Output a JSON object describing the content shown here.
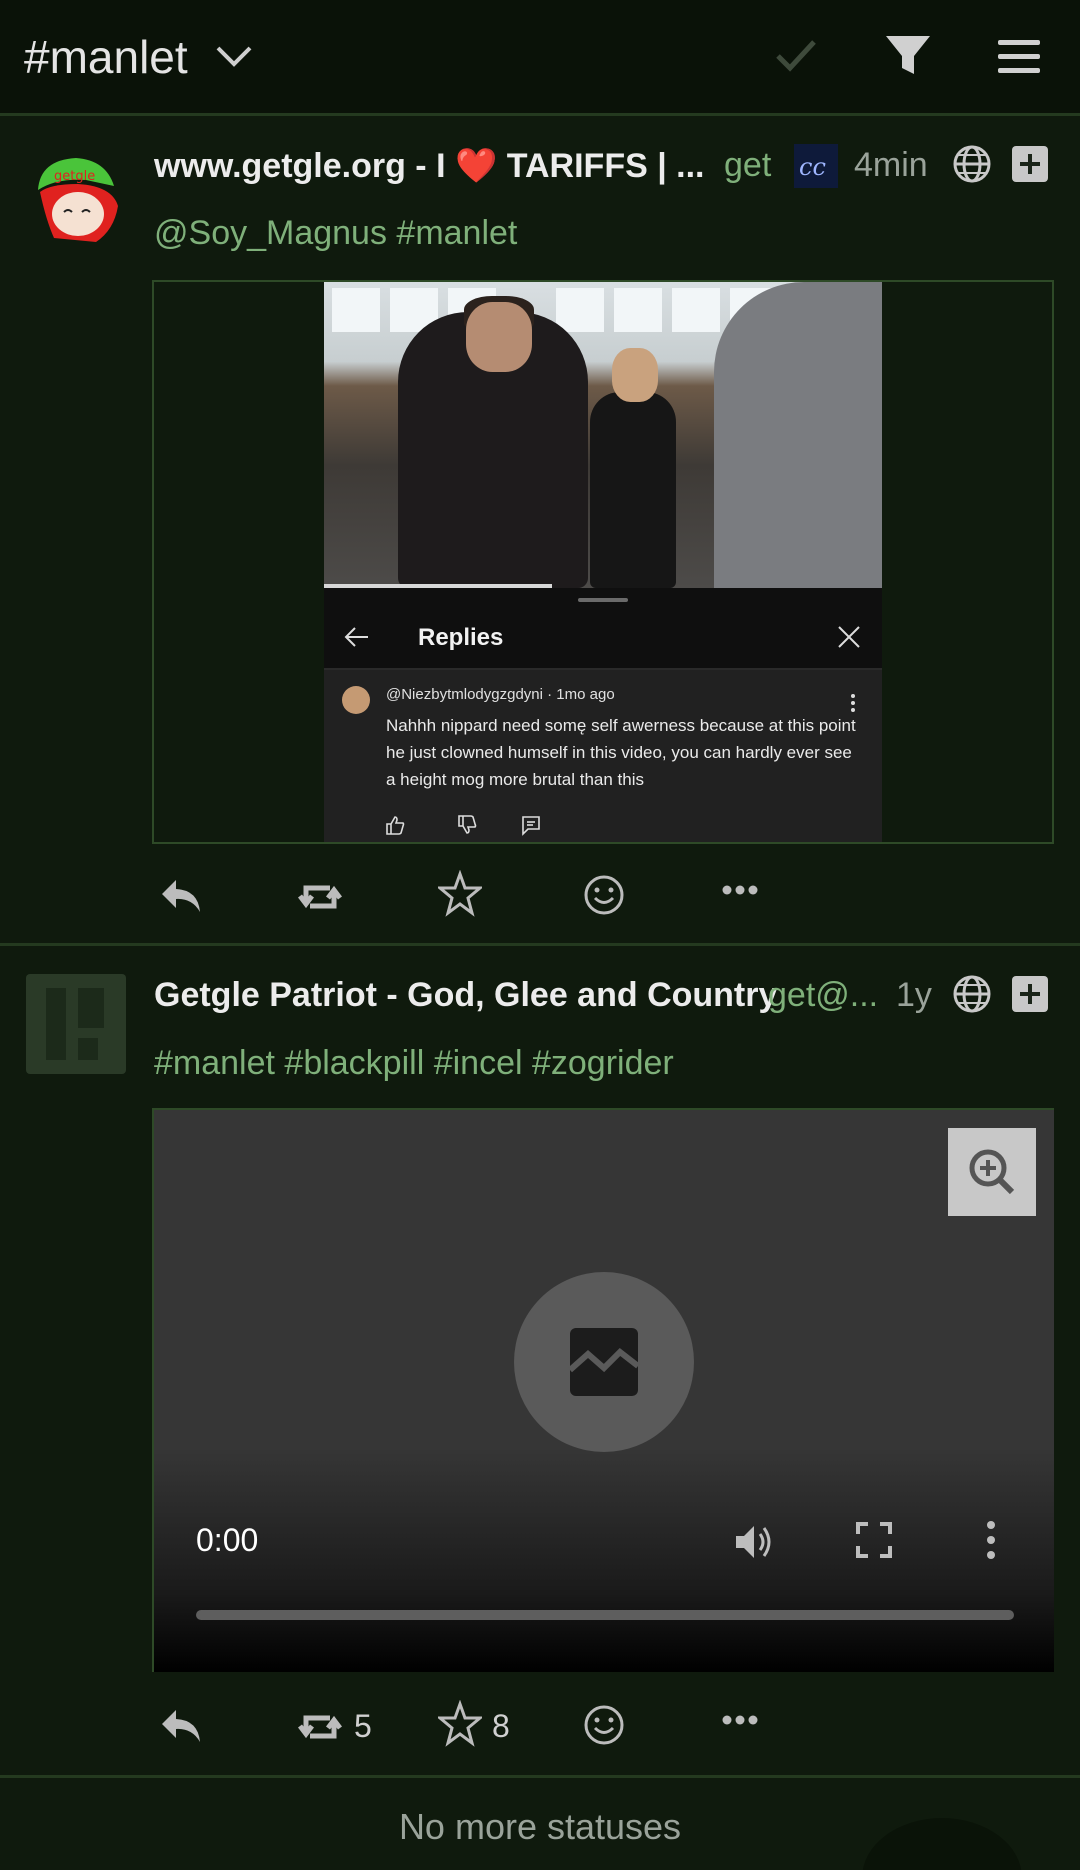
{
  "header": {
    "title": "#manlet",
    "icons": [
      "chevron-down-icon",
      "check-icon",
      "filter-icon",
      "menu-icon"
    ]
  },
  "posts": [
    {
      "display_name": "www.getgle.org - I ❤️ TARIFFS | ...",
      "handle": "get",
      "time": "4min",
      "content": "@Soy_Magnus #manlet",
      "embedded_screenshot": {
        "sheet_title": "Replies",
        "comment_author": "@Niezbytmlodygzgdyni · 1mo ago",
        "comment_text": "Nahhh nippard need somę self awerness because at this point he just clowned humself in this video, you can hardly ever see a height mog more brutal than this"
      },
      "actions": {
        "reply": "",
        "boost": "",
        "favourite": "",
        "react": "",
        "more": ""
      }
    },
    {
      "display_name": "Getgle Patriot - God, Glee and Country",
      "handle": "get@...",
      "time": "1y",
      "content": "#manlet #blackpill #incel #zogrider",
      "video": {
        "time": "0:00"
      },
      "actions": {
        "boost_count": "5",
        "favourite_count": "8"
      }
    }
  ],
  "footer": {
    "end_text": "No more statuses"
  },
  "colors": {
    "background": "#0f1a0d",
    "accent": "#7fb07a",
    "header": "#0a1208"
  }
}
